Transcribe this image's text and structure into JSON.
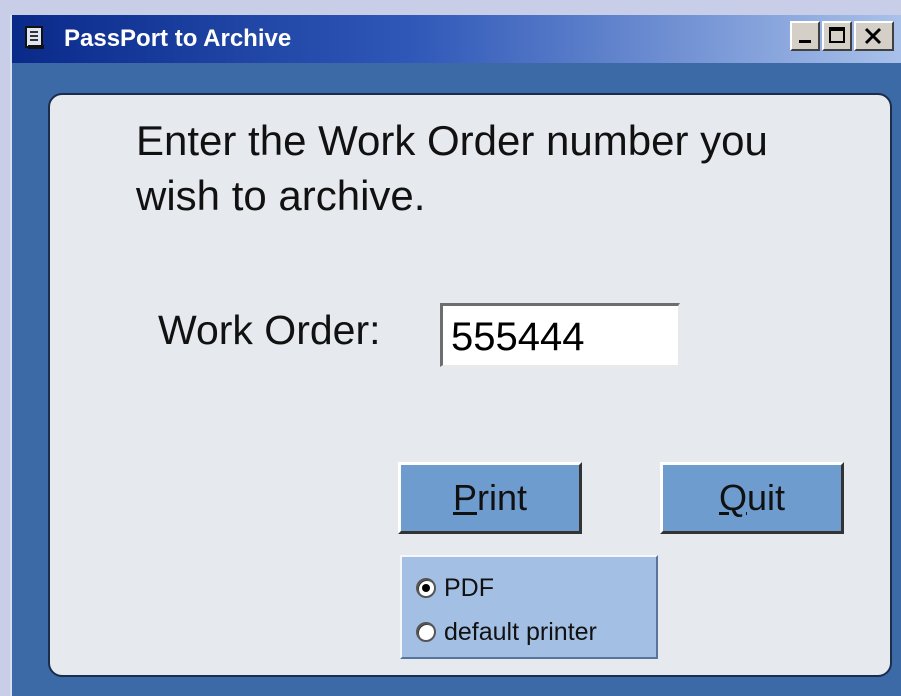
{
  "window": {
    "title": "PassPort to Archive",
    "controls": [
      "minimize-icon",
      "maximize-icon",
      "close-icon"
    ]
  },
  "form": {
    "instruction": "Enter the Work Order number you wish to archive.",
    "work_order_label": "Work Order:",
    "work_order_value": "555444"
  },
  "buttons": {
    "print_prefix": "P",
    "print_rest": "rint",
    "quit_prefix": "Q",
    "quit_rest": "uit"
  },
  "output": {
    "options": [
      "PDF",
      "default printer"
    ],
    "selected": "PDF"
  },
  "colors": {
    "frame": "#3c6aa6",
    "title_bar_start": "#0a2a8a",
    "panel": "#e6e9ee",
    "button": "#6e9ccf",
    "radio_group": "#a3c0e4"
  }
}
